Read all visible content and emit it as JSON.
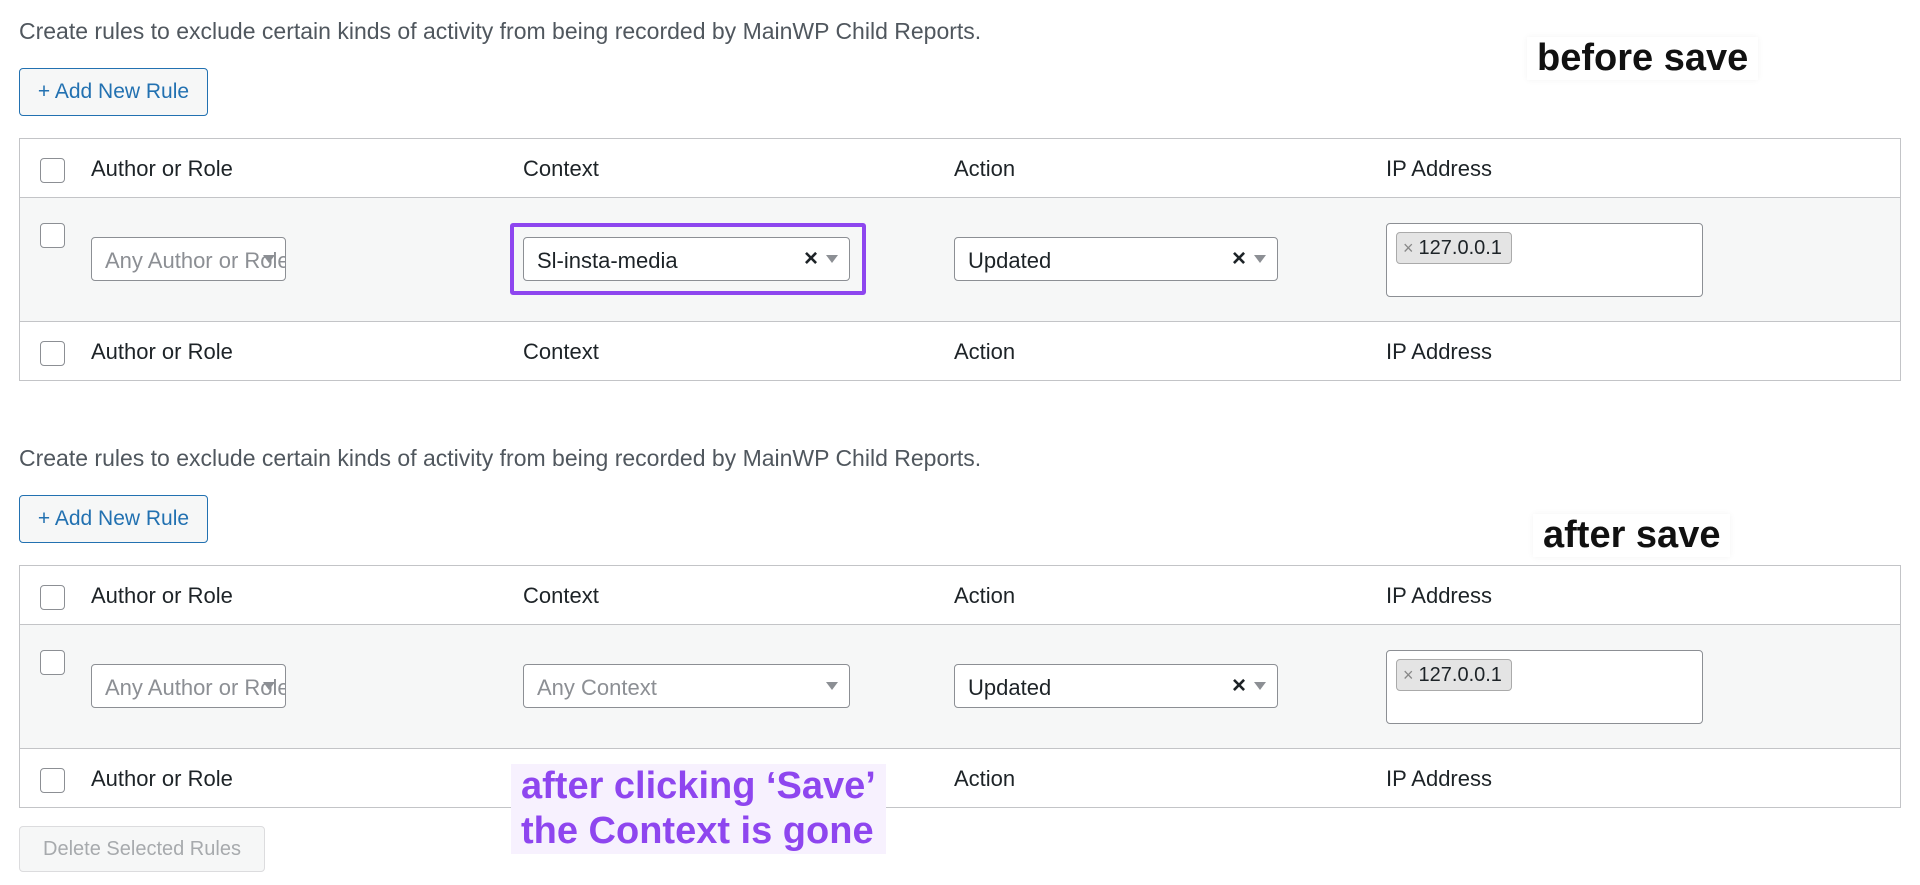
{
  "description": "Create rules to exclude certain kinds of activity from being recorded by MainWP Child Reports.",
  "add_button_label": "+ Add New Rule",
  "columns": {
    "author": "Author or Role",
    "context": "Context",
    "action": "Action",
    "ip": "IP Address"
  },
  "before_rule": {
    "author_placeholder": "Any Author or Role",
    "context_value": "Sl-insta-media",
    "action_value": "Updated",
    "ip_tag": "127.0.0.1"
  },
  "after_rule": {
    "author_placeholder": "Any Author or Role",
    "context_placeholder": "Any Context",
    "action_value": "Updated",
    "ip_tag": "127.0.0.1"
  },
  "annotations": {
    "before": "before save",
    "after": "after save",
    "callout_line1": "after clicking ‘Save’",
    "callout_line2": "the Context is gone",
    "highlight_color": "#8e46ef"
  },
  "delete_button_label": "Delete Selected Rules",
  "icons": {
    "clear": "×",
    "tag_remove": "×",
    "dropdown": "chevron-down-icon"
  }
}
